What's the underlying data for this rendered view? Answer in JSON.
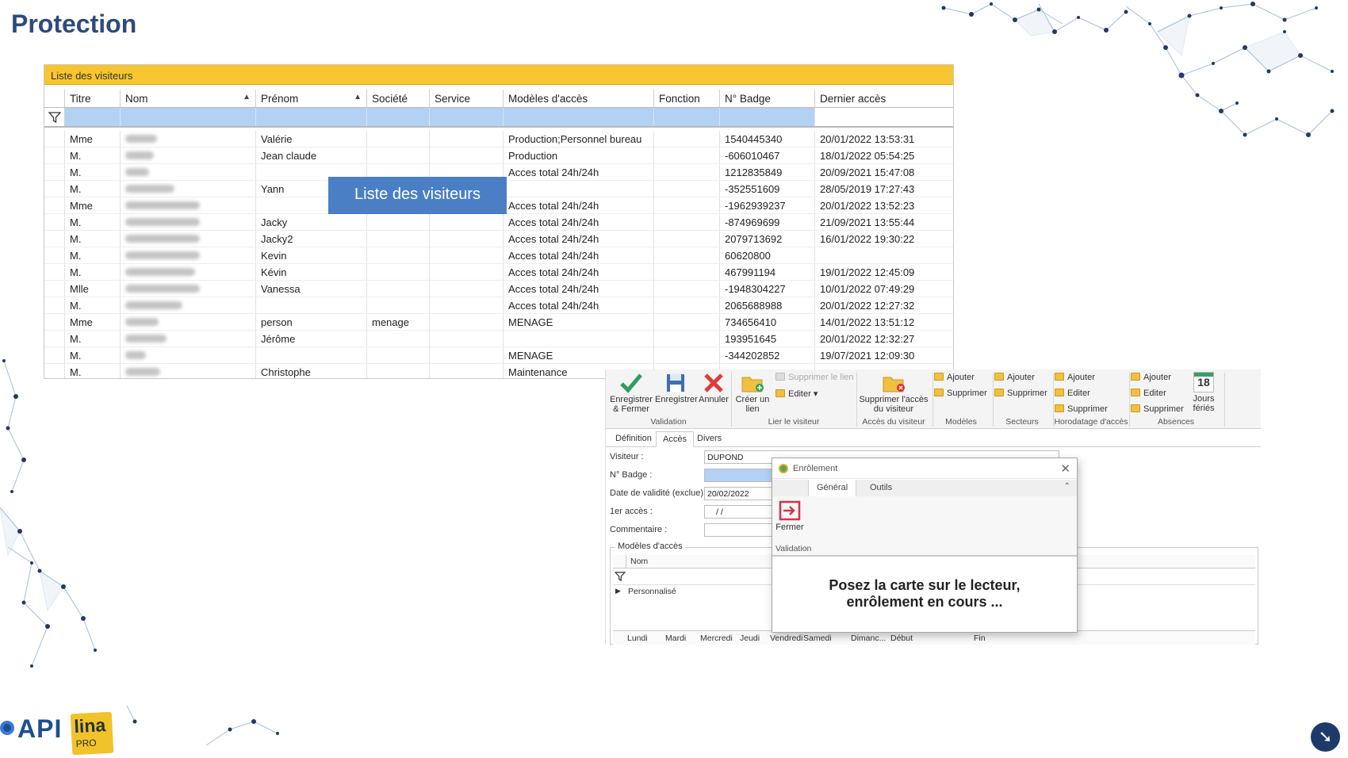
{
  "slide": {
    "title": "Protection"
  },
  "visitor_list": {
    "title": "Liste des visiteurs",
    "columns": [
      "Titre",
      "Nom",
      "Prénom",
      "Société",
      "Service",
      "Modèles d'accès",
      "Fonction",
      "N° Badge",
      "Dernier accès"
    ],
    "rows": [
      [
        "Mme",
        "",
        "Valérie",
        "",
        "",
        "Production;Personnel bureau",
        "",
        "1540445340",
        "20/01/2022 13:53:31"
      ],
      [
        "M.",
        "",
        "Jean claude",
        "",
        "",
        "Production",
        "",
        "-606010467",
        "18/01/2022 05:54:25"
      ],
      [
        "M.",
        "",
        "",
        "",
        "",
        "Acces total 24h/24h",
        "",
        "1212835849",
        "20/09/2021 15:47:08"
      ],
      [
        "M.",
        "",
        "Yann",
        "",
        "",
        "",
        "",
        "-352551609",
        "28/05/2019 17:27:43"
      ],
      [
        "Mme",
        "",
        "",
        "",
        "",
        "Acces total 24h/24h",
        "",
        "-1962939237",
        "20/01/2022 13:52:23"
      ],
      [
        "M.",
        "",
        "Jacky",
        "",
        "",
        "Acces total 24h/24h",
        "",
        "-874969699",
        "21/09/2021 13:55:44"
      ],
      [
        "M.",
        "",
        "Jacky2",
        "",
        "",
        "Acces total 24h/24h",
        "",
        "2079713692",
        "16/01/2022 19:30:22"
      ],
      [
        "M.",
        "",
        "Kevin",
        "",
        "",
        "Acces total 24h/24h",
        "",
        "60620800",
        ""
      ],
      [
        "M.",
        "",
        "Kévin",
        "",
        "",
        "Acces total 24h/24h",
        "",
        "467991194",
        "19/01/2022 12:45:09"
      ],
      [
        "Mlle",
        "",
        "Vanessa",
        "",
        "",
        "Acces total 24h/24h",
        "",
        "-1948304227",
        "10/01/2022 07:49:29"
      ],
      [
        "M.",
        "",
        "",
        "",
        "",
        "Acces total 24h/24h",
        "",
        "2065688988",
        "20/01/2022 12:27:32"
      ],
      [
        "Mme",
        "",
        "person",
        "menage",
        "",
        "MENAGE",
        "",
        "734656410",
        "14/01/2022 13:51:12"
      ],
      [
        "M.",
        "",
        "Jérôme",
        "",
        "",
        "",
        "",
        "193951645",
        "20/01/2022 12:32:27"
      ],
      [
        "M.",
        "",
        "",
        "",
        "",
        "MENAGE",
        "",
        "-344202852",
        "19/07/2021 12:09:30"
      ],
      [
        "M.",
        "",
        "Christophe",
        "",
        "",
        "Maintenance",
        "",
        "",
        ""
      ]
    ]
  },
  "callout": {
    "text": "Liste des visiteurs"
  },
  "ribbon": {
    "save_close": "Enregistrer & Fermer",
    "save": "Enregistrer",
    "cancel": "Annuler",
    "group_validation": "Validation",
    "create_link": "Créer un lien",
    "remove_link": "Supprimer le lien",
    "edit": "Editer",
    "group_link": "Lier le visiteur",
    "remove_access": "Supprimer l'accès du visiteur",
    "group_access": "Accès du visiteur",
    "add": "Ajouter",
    "delete": "Supprimer",
    "group_models": "Modèles",
    "group_sectors": "Secteurs",
    "group_timestamp": "Horodatage d'accès",
    "holidays_num": "18",
    "holidays": "Jours fériés",
    "group_absences": "Absences"
  },
  "tabs": [
    "Définition",
    "Accès",
    "Divers"
  ],
  "form": {
    "visitor_label": "Visiteur :",
    "visitor_value": "DUPOND",
    "badge_label": "N° Badge :",
    "validity_label": "Date de validité (exclue) :",
    "validity_value": "20/02/2022",
    "first_access_label": "1er accès :",
    "first_access_value": "/   /",
    "comment_label": "Commentaire :",
    "models_legend": "Modèles d'accès",
    "models_col_name": "Nom",
    "models_row": "Personnalisé",
    "days": [
      "Lundi",
      "Mardi",
      "Mercredi",
      "Jeudi",
      "Vendredi",
      "Samedi",
      "Dimanc...",
      "Début",
      "Fin"
    ]
  },
  "dialog": {
    "title": "Enrôlement",
    "tabs": [
      "Général",
      "Outils"
    ],
    "close_btn": "Fermer",
    "group": "Validation",
    "message_line1": "Posez la carte sur le lecteur,",
    "message_line2": "enrôlement en cours ..."
  },
  "logos": {
    "api": "API",
    "lina": "lina",
    "lina_sub": "PRO"
  },
  "colors": {
    "title": "#2e4a7d",
    "list_header": "#f7c531",
    "filter_row": "#b3d1f3",
    "callout": "#4a7fc6",
    "network": "#1e3a6b"
  }
}
